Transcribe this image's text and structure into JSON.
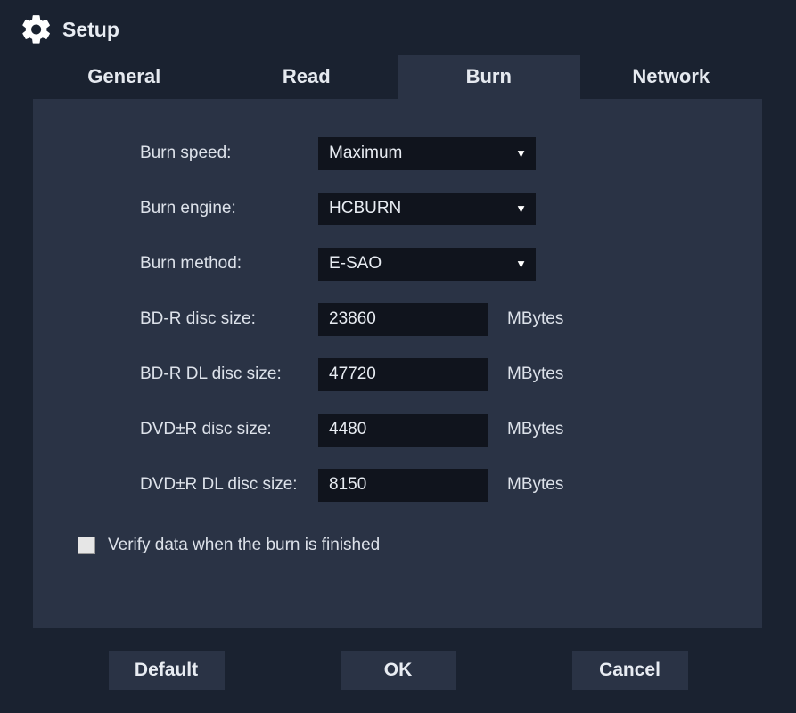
{
  "title": "Setup",
  "tabs": {
    "general": "General",
    "read": "Read",
    "burn": "Burn",
    "network": "Network",
    "active": "burn"
  },
  "fields": {
    "burn_speed": {
      "label": "Burn speed:",
      "value": "Maximum",
      "type": "select"
    },
    "burn_engine": {
      "label": "Burn engine:",
      "value": "HCBURN",
      "type": "select"
    },
    "burn_method": {
      "label": "Burn method:",
      "value": "E-SAO",
      "type": "select"
    },
    "bdr_size": {
      "label": "BD-R disc size:",
      "value": "23860",
      "unit": "MBytes",
      "type": "text"
    },
    "bdr_dl_size": {
      "label": "BD-R DL disc size:",
      "value": "47720",
      "unit": "MBytes",
      "type": "text"
    },
    "dvdr_size": {
      "label": "DVD±R disc size:",
      "value": "4480",
      "unit": "MBytes",
      "type": "text"
    },
    "dvdr_dl_size": {
      "label": "DVD±R DL disc size:",
      "value": "8150",
      "unit": "MBytes",
      "type": "text"
    }
  },
  "verify": {
    "label": "Verify data when the burn is finished",
    "checked": false
  },
  "buttons": {
    "default": "Default",
    "ok": "OK",
    "cancel": "Cancel"
  }
}
